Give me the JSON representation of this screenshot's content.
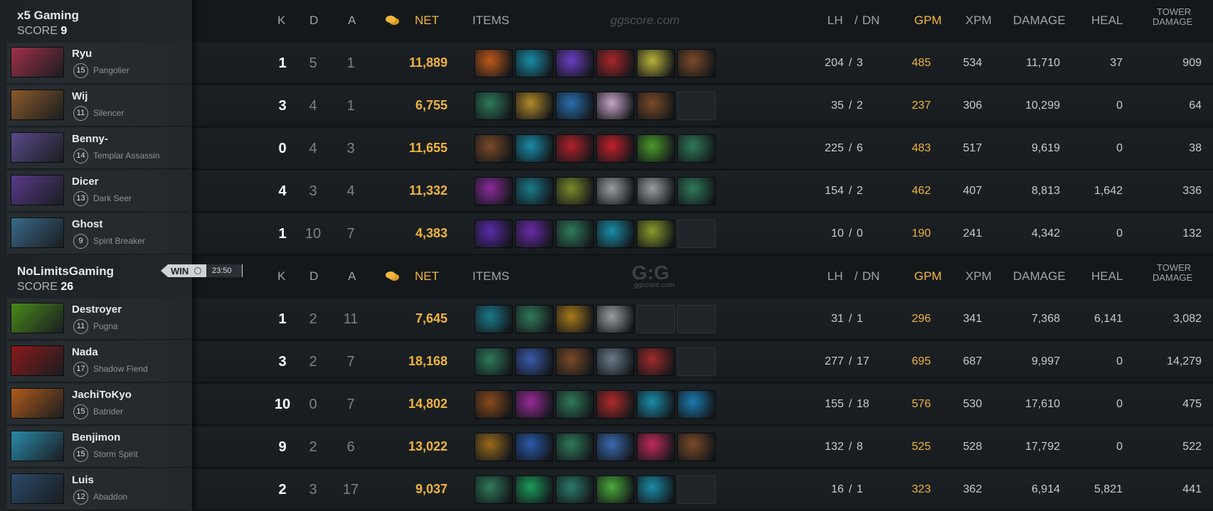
{
  "headers": {
    "k": "K",
    "d": "D",
    "a": "A",
    "net": "NET",
    "items": "ITEMS",
    "lh": "LH",
    "slash": "/",
    "dn": "DN",
    "gpm": "GPM",
    "xpm": "XPM",
    "damage": "DAMAGE",
    "heal": "HEAL",
    "tower1": "TOWER",
    "tower2": "DAMAGE"
  },
  "watermark1": "ggscore.com",
  "watermark2": "G:G",
  "teams": [
    {
      "name": "x5 Gaming",
      "score_label": "SCORE",
      "score": "9",
      "players": [
        {
          "name": "Ryu",
          "level": "15",
          "hero": "Pangolier",
          "k": "1",
          "d": "5",
          "a": "1",
          "net": "11,889",
          "items": [
            "#c05a1a",
            "#1a8ca8",
            "#6a3ec2",
            "#a8262a",
            "#b7b03a",
            "#7a4a28"
          ],
          "lh": "204",
          "dn": "3",
          "gpm": "485",
          "xpm": "534",
          "damage": "11,710",
          "heal": "37",
          "tower": "909",
          "portrait": "#a0304a"
        },
        {
          "name": "Wij",
          "level": "11",
          "hero": "Silencer",
          "k": "3",
          "d": "4",
          "a": "1",
          "net": "6,755",
          "items": [
            "#2f7a5a",
            "#b38a2a",
            "#2a6fb0",
            "#c7a5c8",
            "#7a4a28",
            ""
          ],
          "lh": "35",
          "dn": "2",
          "gpm": "237",
          "xpm": "306",
          "damage": "10,299",
          "heal": "0",
          "tower": "64",
          "portrait": "#8a5a2a"
        },
        {
          "name": "Benny-",
          "level": "14",
          "hero": "Templar Assassin",
          "k": "0",
          "d": "4",
          "a": "3",
          "net": "11,655",
          "items": [
            "#7a4a28",
            "#1a8ca8",
            "#b0202a",
            "#c0202a",
            "#4a9a2a",
            "#2f7a5a"
          ],
          "lh": "225",
          "dn": "6",
          "gpm": "483",
          "xpm": "517",
          "damage": "9,619",
          "heal": "0",
          "tower": "38",
          "portrait": "#5a4a8a"
        },
        {
          "name": "Dicer",
          "level": "13",
          "hero": "Dark Seer",
          "k": "4",
          "d": "3",
          "a": "4",
          "net": "11,332",
          "items": [
            "#8a2a9a",
            "#1a7a8a",
            "#7a8a2a",
            "#9a9ea2",
            "#9a9ea2",
            "#2f7a5a"
          ],
          "lh": "154",
          "dn": "2",
          "gpm": "462",
          "xpm": "407",
          "damage": "8,813",
          "heal": "1,642",
          "tower": "336",
          "portrait": "#5a3a8a"
        },
        {
          "name": "Ghost",
          "level": "9",
          "hero": "Spirit Breaker",
          "k": "1",
          "d": "10",
          "a": "7",
          "net": "4,383",
          "items": [
            "#5a2aaa",
            "#6a2aaa",
            "#2f7a5a",
            "#1a8ca8",
            "#8a9a2a",
            ""
          ],
          "lh": "10",
          "dn": "0",
          "gpm": "190",
          "xpm": "241",
          "damage": "4,342",
          "heal": "0",
          "tower": "132",
          "portrait": "#3a6a8a"
        }
      ]
    },
    {
      "name": "NoLimitsGaming",
      "score_label": "SCORE",
      "score": "26",
      "result": "WIN",
      "duration": "23:50",
      "players": [
        {
          "name": "Destroyer",
          "level": "11",
          "hero": "Pugna",
          "k": "1",
          "d": "2",
          "a": "11",
          "net": "7,645",
          "items": [
            "#1a7a8a",
            "#2f7a5a",
            "#a87a1a",
            "#9a9ea2",
            "",
            ""
          ],
          "lh": "31",
          "dn": "1",
          "gpm": "296",
          "xpm": "341",
          "damage": "7,368",
          "heal": "6,141",
          "tower": "3,082",
          "portrait": "#4a8a1a"
        },
        {
          "name": "Nada",
          "level": "17",
          "hero": "Shadow Fiend",
          "k": "3",
          "d": "2",
          "a": "7",
          "net": "18,168",
          "items": [
            "#2f7a5a",
            "#3a5aaa",
            "#7a4a28",
            "#6a7a8a",
            "#a02a2a",
            ""
          ],
          "lh": "277",
          "dn": "17",
          "gpm": "695",
          "xpm": "687",
          "damage": "9,997",
          "heal": "0",
          "tower": "14,279",
          "portrait": "#8a1a1a"
        },
        {
          "name": "JachiToKyo",
          "level": "15",
          "hero": "Batrider",
          "k": "10",
          "d": "0",
          "a": "7",
          "net": "14,802",
          "items": [
            "#8a4a1a",
            "#9a2a9a",
            "#2f7a5a",
            "#b02a2a",
            "#1a8ca8",
            "#1a7ab0"
          ],
          "lh": "155",
          "dn": "18",
          "gpm": "576",
          "xpm": "530",
          "damage": "17,610",
          "heal": "0",
          "tower": "475",
          "portrait": "#b05a1a"
        },
        {
          "name": "Benjimon",
          "level": "15",
          "hero": "Storm Spirit",
          "k": "9",
          "d": "2",
          "a": "6",
          "net": "13,022",
          "items": [
            "#9a6a1a",
            "#2a5aaa",
            "#2f7a5a",
            "#3a6ab0",
            "#c02a5a",
            "#7a4a28"
          ],
          "lh": "132",
          "dn": "8",
          "gpm": "525",
          "xpm": "528",
          "damage": "17,792",
          "heal": "0",
          "tower": "522",
          "portrait": "#2a8aaa"
        },
        {
          "name": "Luis",
          "level": "12",
          "hero": "Abaddon",
          "k": "2",
          "d": "3",
          "a": "17",
          "net": "9,037",
          "items": [
            "#2f7a5a",
            "#1a9a5a",
            "#2a7a6a",
            "#4aaa3a",
            "#1a8ca8",
            ""
          ],
          "lh": "16",
          "dn": "1",
          "gpm": "323",
          "xpm": "362",
          "damage": "6,914",
          "heal": "5,821",
          "tower": "441",
          "portrait": "#2a4a6a"
        }
      ]
    }
  ]
}
